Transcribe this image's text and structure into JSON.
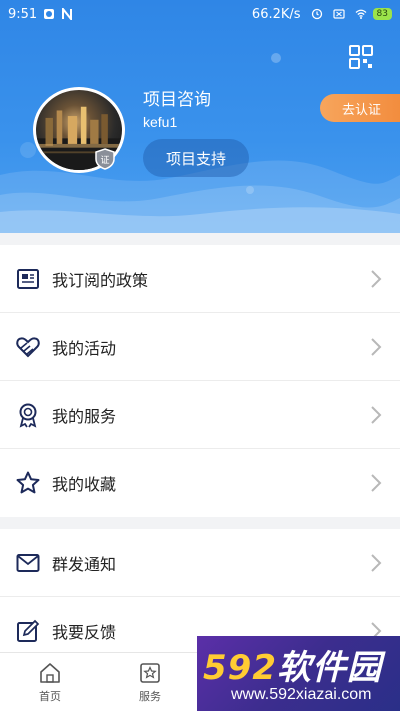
{
  "status_bar": {
    "time": "9:51",
    "network_speed": "66.2K/s",
    "battery": "83"
  },
  "header": {
    "project_title": "项目咨询",
    "username": "kefu1",
    "support_button": "项目支持",
    "certify_button": "去认证",
    "badge_text": "证"
  },
  "menu_group_1": [
    {
      "label": "我订阅的政策",
      "icon": "newspaper-icon"
    },
    {
      "label": "我的活动",
      "icon": "heart-handshake-icon"
    },
    {
      "label": "我的服务",
      "icon": "medal-icon"
    },
    {
      "label": "我的收藏",
      "icon": "star-icon"
    }
  ],
  "menu_group_2": [
    {
      "label": "群发通知",
      "icon": "mail-icon"
    },
    {
      "label": "我要反馈",
      "icon": "edit-icon"
    }
  ],
  "tabbar": [
    {
      "label": "首页",
      "icon": "home-icon"
    },
    {
      "label": "服务",
      "icon": "service-icon"
    }
  ],
  "watermark": {
    "logo_num": "592",
    "logo_text": "软件园",
    "url": "www.592xiazai.com"
  },
  "colors": {
    "header_blue": "#2f86e6",
    "certify_orange": "#f28b3c",
    "icon_navy": "#1d2a5a"
  }
}
